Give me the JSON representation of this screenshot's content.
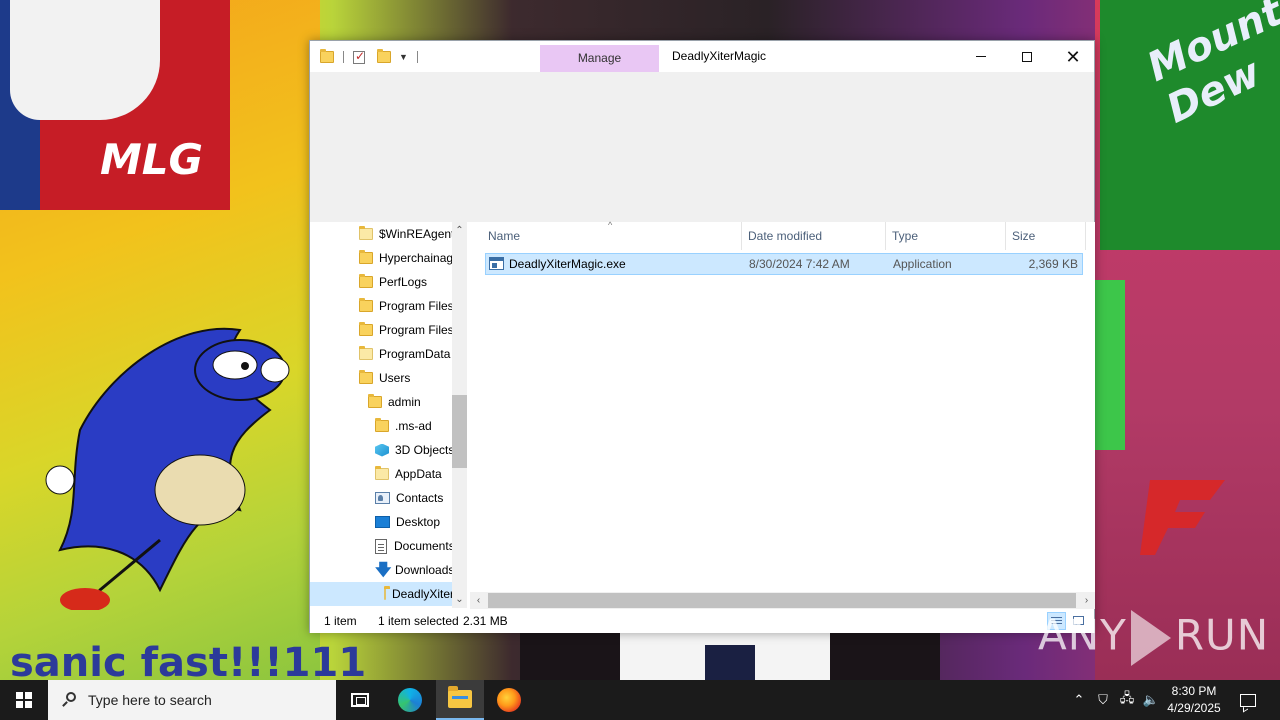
{
  "wallpaper": {
    "mlg_text": "MLG",
    "sonic_text": "sanic fast!!!111",
    "dew_text": "Mountain Dew"
  },
  "window": {
    "title": "DeadlyXiterMagic",
    "manage_tab": "Manage",
    "controls": {
      "minimize": "minimize",
      "maximize": "maximize",
      "close": "close"
    }
  },
  "navpane": {
    "items": [
      {
        "label": "$WinREAgent",
        "icon": "folder-icon"
      },
      {
        "label": "Hyperchainag",
        "icon": "folder-icon"
      },
      {
        "label": "PerfLogs",
        "icon": "folder-icon"
      },
      {
        "label": "Program Files",
        "icon": "folder-icon"
      },
      {
        "label": "Program Files",
        "icon": "folder-icon"
      },
      {
        "label": "ProgramData",
        "icon": "folder-icon"
      },
      {
        "label": "Users",
        "icon": "folder-icon"
      },
      {
        "label": "admin",
        "icon": "folder-icon"
      },
      {
        "label": ".ms-ad",
        "icon": "folder-icon"
      },
      {
        "label": "3D Objects",
        "icon": "3d-objects-icon"
      },
      {
        "label": "AppData",
        "icon": "folder-icon"
      },
      {
        "label": "Contacts",
        "icon": "contacts-icon"
      },
      {
        "label": "Desktop",
        "icon": "desktop-icon"
      },
      {
        "label": "Documents",
        "icon": "documents-icon"
      },
      {
        "label": "Downloads",
        "icon": "downloads-icon"
      },
      {
        "label": "DeadlyXiterMagic",
        "icon": "folder-icon"
      }
    ]
  },
  "filelist": {
    "columns": {
      "name": "Name",
      "date": "Date modified",
      "type": "Type",
      "size": "Size"
    },
    "rows": [
      {
        "name": "DeadlyXiterMagic.exe",
        "date": "8/30/2024 7:42 AM",
        "type": "Application",
        "size": "2,369 KB"
      }
    ]
  },
  "statusbar": {
    "item_count": "1 item",
    "selected": "1 item selected",
    "selected_size": "2.31 MB"
  },
  "watermark": {
    "left": "ANY",
    "right": "RUN"
  },
  "taskbar": {
    "search_placeholder": "Type here to search",
    "time": "8:30 PM",
    "date": "4/29/2025"
  },
  "colors": {
    "manage_tab": "#e9c7f4",
    "selection": "#cce8ff",
    "taskbar": "#1b1b1b"
  }
}
